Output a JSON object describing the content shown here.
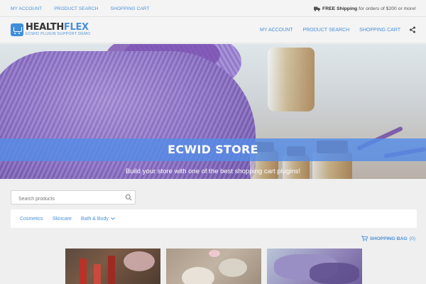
{
  "topbar": {
    "links": [
      "MY ACCOUNT",
      "PRODUCT SEARCH",
      "SHOPPING CART"
    ],
    "shipping_bold": "FREE Shipping",
    "shipping_rest": "for orders of $200 or more!"
  },
  "header": {
    "logo_part1": "HEALTH",
    "logo_part2": "FLEX",
    "logo_tagline": "ECWID PLUGIN SUPPORT DEMO",
    "nav": [
      "MY ACCOUNT",
      "PRODUCT SEARCH",
      "SHOPPING CART"
    ]
  },
  "hero": {
    "title": "ECWID STORE",
    "subtitle": "Build your store with one of the best shopping cart plugins!"
  },
  "search": {
    "placeholder": "Search products"
  },
  "categories": [
    "Cosmetics",
    "Skincare",
    "Bath & Body"
  ],
  "bag": {
    "label": "SHOPPING BAG",
    "count": "(0)"
  },
  "icons": {
    "truck": "truck-icon",
    "share": "share-icon",
    "search": "search-icon",
    "cart": "cart-icon",
    "chevron": "chevron-down-icon"
  },
  "colors": {
    "accent": "#4a90d9",
    "band": "#558ce6",
    "background": "#efefef"
  }
}
